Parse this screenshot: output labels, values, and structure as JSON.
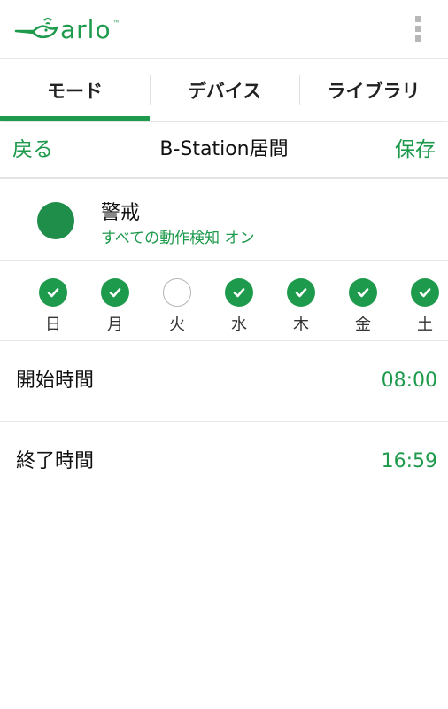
{
  "app": {
    "logo_text": "arlo",
    "logo_tm": "™"
  },
  "header": {
    "menu_icon": "kebab-menu-icon"
  },
  "tabs": [
    {
      "label": "モード",
      "active": true
    },
    {
      "label": "デバイス",
      "active": false
    },
    {
      "label": "ライブラリ",
      "active": false
    }
  ],
  "nav": {
    "back_label": "戻る",
    "title": "B-Station居間",
    "save_label": "保存"
  },
  "mode": {
    "name": "警戒",
    "description": "すべての動作検知 オン",
    "color": "#1f8e4a"
  },
  "days": [
    {
      "label": "日",
      "checked": true
    },
    {
      "label": "月",
      "checked": true
    },
    {
      "label": "火",
      "checked": false
    },
    {
      "label": "水",
      "checked": true
    },
    {
      "label": "木",
      "checked": true
    },
    {
      "label": "金",
      "checked": true
    },
    {
      "label": "土",
      "checked": true
    }
  ],
  "schedule": {
    "start_label": "開始時間",
    "start_value": "08:00",
    "end_label": "終了時間",
    "end_value": "16:59"
  },
  "colors": {
    "accent": "#1e9a4c"
  }
}
